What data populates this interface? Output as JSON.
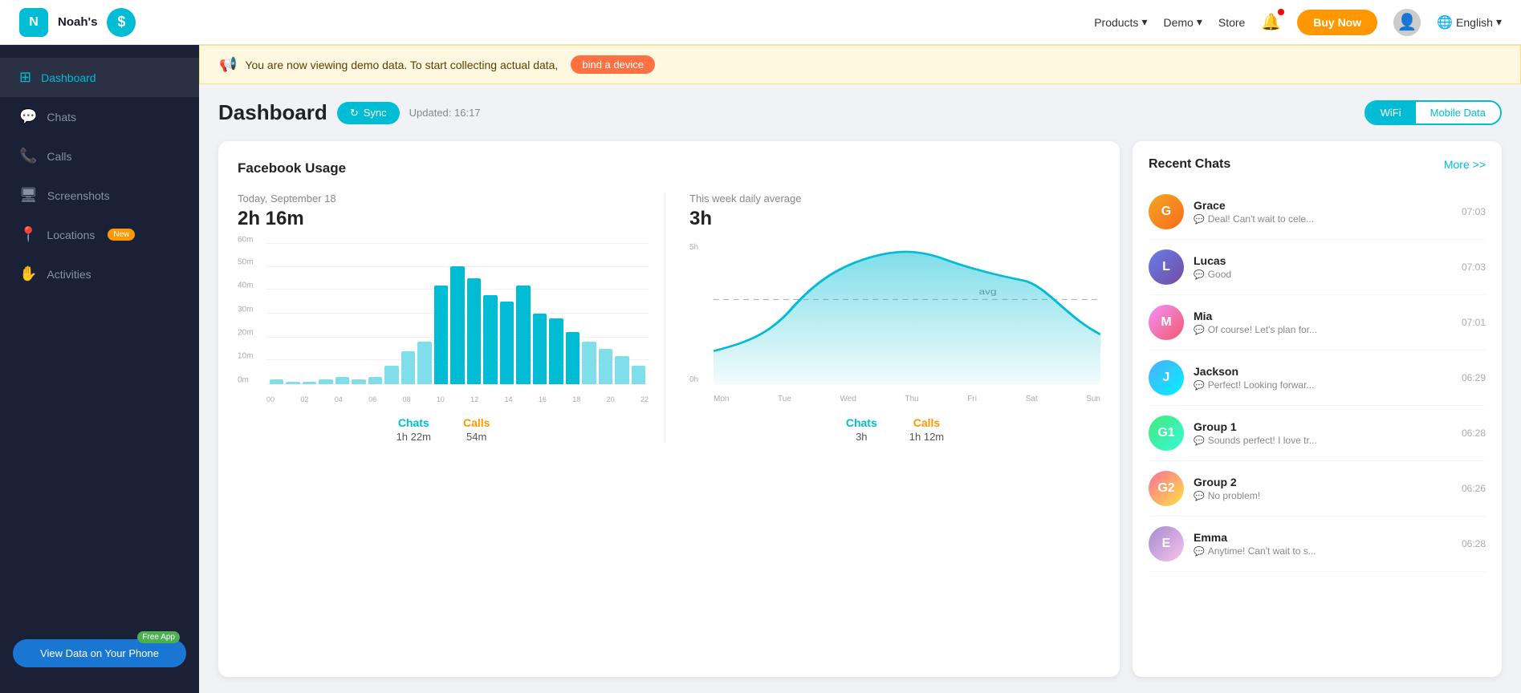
{
  "nav": {
    "app_name": "Noah's",
    "products_label": "Products",
    "demo_label": "Demo",
    "store_label": "Store",
    "buy_now_label": "Buy Now",
    "english_label": "English"
  },
  "sidebar": {
    "items": [
      {
        "id": "dashboard",
        "label": "Dashboard",
        "icon": "⊞",
        "active": true
      },
      {
        "id": "chats",
        "label": "Chats",
        "icon": "💬",
        "active": false
      },
      {
        "id": "calls",
        "label": "Calls",
        "icon": "📞",
        "active": false
      },
      {
        "id": "screenshots",
        "label": "Screenshots",
        "icon": "🖥",
        "active": false
      },
      {
        "id": "locations",
        "label": "Locations",
        "icon": "📍",
        "active": false,
        "badge": "New"
      },
      {
        "id": "activities",
        "label": "Activities",
        "icon": "✋",
        "active": false
      }
    ],
    "view_data_btn": "View Data on Your Phone",
    "free_app_badge": "Free App"
  },
  "banner": {
    "text": "You are now viewing demo data. To start collecting actual data,",
    "bind_label": "bind a device"
  },
  "dashboard": {
    "title": "Dashboard",
    "sync_label": "Sync",
    "updated_text": "Updated: 16:17",
    "wifi_label": "WiFi",
    "mobile_data_label": "Mobile Data"
  },
  "facebook_usage": {
    "panel_title": "Facebook Usage",
    "today_label": "Today, September 18",
    "today_value": "2h 16m",
    "week_label": "This week daily average",
    "week_value": "3h",
    "bars": [
      2,
      1,
      1,
      2,
      3,
      2,
      3,
      8,
      14,
      18,
      42,
      50,
      45,
      38,
      35,
      42,
      30,
      28,
      22,
      18,
      15,
      12,
      8
    ],
    "bar_max": 60,
    "x_labels": [
      "00",
      "02",
      "04",
      "06",
      "08",
      "10",
      "12",
      "14",
      "16",
      "18",
      "20",
      "22"
    ],
    "y_labels": [
      "60m",
      "50m",
      "40m",
      "30m",
      "20m",
      "10m",
      "0m"
    ],
    "today_chats_label": "Chats",
    "today_calls_label": "Calls",
    "today_chats_value": "1h 22m",
    "today_calls_value": "54m",
    "week_chats_label": "Chats",
    "week_calls_label": "Calls",
    "week_chats_value": "3h",
    "week_calls_value": "1h 12m",
    "line_y_labels": [
      "5h",
      "",
      "",
      "",
      "0h"
    ],
    "line_x_labels": [
      "Mon",
      "Tue",
      "Wed",
      "Thu",
      "Fri",
      "Sat",
      "Sun"
    ],
    "avg_label": "avg"
  },
  "recent_chats": {
    "title": "Recent Chats",
    "more_label": "More >>",
    "items": [
      {
        "name": "Grace",
        "preview": "Deal! Can't wait to cele...",
        "time": "07:03",
        "av_class": "av-grace",
        "initial": "G"
      },
      {
        "name": "Lucas",
        "preview": "Good",
        "time": "07:03",
        "av_class": "av-lucas",
        "initial": "L"
      },
      {
        "name": "Mia",
        "preview": "Of course! Let's plan for...",
        "time": "07:01",
        "av_class": "av-mia",
        "initial": "M"
      },
      {
        "name": "Jackson",
        "preview": "Perfect! Looking forwar...",
        "time": "06:29",
        "av_class": "av-jackson",
        "initial": "J"
      },
      {
        "name": "Group 1",
        "preview": "Sounds perfect! I love tr...",
        "time": "06:28",
        "av_class": "av-group1",
        "initial": "G1"
      },
      {
        "name": "Group 2",
        "preview": "No problem!",
        "time": "06:26",
        "av_class": "av-group2",
        "initial": "G2"
      },
      {
        "name": "Emma",
        "preview": "Anytime! Can't wait to s...",
        "time": "06:28",
        "av_class": "av-emma",
        "initial": "E"
      }
    ]
  }
}
